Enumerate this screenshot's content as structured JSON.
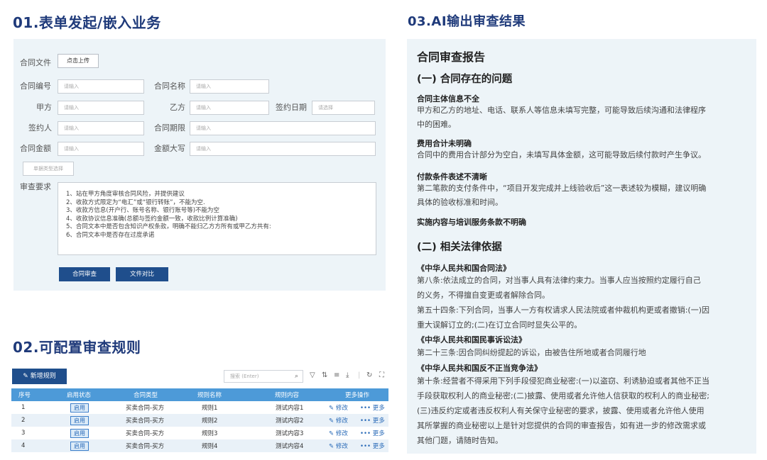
{
  "sections": {
    "s1": "01.表单发起/嵌入业务",
    "s2": "02.可配置审查规则",
    "s3": "03.AI输出审查结果"
  },
  "form": {
    "file_label": "合同文件",
    "upload_button": "点击上传",
    "fields": {
      "contract_no": "合同编号",
      "contract_name": "合同名称",
      "party_a": "甲方",
      "party_b": "乙方",
      "sign_date": "签约日期",
      "signer": "签约人",
      "period": "合同期限",
      "amount": "合同金额",
      "amount_upper": "金额大写"
    },
    "placeholder_input": "请输入",
    "placeholder_select": "请选择",
    "type_select": "单据类型选择",
    "req_label": "审查要求",
    "requirements": [
      "1、站在甲方角度审核合同风险，并提供建议",
      "2、收款方式限定为“电汇”或“银行转账”，不能为空.",
      "3、收款方信息(开户行、账号名称、银行账号等)不能为空",
      "4、收款协议信息准确(总额与签约金额一致，收款比例计算准确)",
      "5、合同文本中是否包含知识产权条款，明确不能归乙方方所有或甲乙方共有:",
      "6、合同文本中是否存在过度承诺"
    ],
    "review_button": "合同审查",
    "compare_button": "文件对比"
  },
  "rules": {
    "add_button": "新增规则",
    "search_placeholder": "搜索 (Enter)",
    "columns": [
      "序号",
      "启用状态",
      "合同类型",
      "规则名称",
      "规则内容",
      "更多操作"
    ],
    "rows": [
      {
        "no": "1",
        "status": "启用",
        "type": "买卖合同-买方",
        "name": "规则1",
        "content": "测试内容1",
        "edit": "修改",
        "more": "更多"
      },
      {
        "no": "2",
        "status": "启用",
        "type": "买卖合同-买方",
        "name": "规则2",
        "content": "测试内容2",
        "edit": "修改",
        "more": "更多"
      },
      {
        "no": "3",
        "status": "启用",
        "type": "买卖合同-买方",
        "name": "规则3",
        "content": "测试内容3",
        "edit": "修改",
        "more": "更多"
      },
      {
        "no": "4",
        "status": "启用",
        "type": "买卖合同-买方",
        "name": "规则4",
        "content": "测试内容4",
        "edit": "修改",
        "more": "更多"
      }
    ]
  },
  "report": {
    "title": "合同审查报告",
    "h_problems": "(一) 合同存在的问题",
    "p1_title": "合同主体信息不全",
    "p1_lines": [
      "甲方和乙方的地址、电话、联系人等信息未填写完整，可能导致后续沟通和法律程序",
      "中的困难。"
    ],
    "p2_title": "费用合计未明确",
    "p2_lines": [
      "合同中的费用合计部分为空白，未填写具体金额，这可能导致后续付款时产生争议。"
    ],
    "p3_title": "付款条件表述不清晰",
    "p3_lines": [
      "第二笔款的支付条件中，“项目开发完成并上线验收后”这一表述较为模糊，建议明确",
      "具体的验收标准和时间。"
    ],
    "p4_title": "实施内容与培训服务条款不明确",
    "h_law": "(二) 相关法律依据",
    "law1": "《中华人民共和国合同法》",
    "law1_lines": [
      "第八条:依法成立的合同，对当事人具有法律约束力。当事人应当按照约定履行自己",
      "的义务，不得擅自变更或者解除合同。",
      "第五十四条:下列合同，当事人一方有权请求人民法院或者仲裁机构更或者撤销:(一)因",
      "重大误解订立的;(二)在订立合同时显失公平的。"
    ],
    "law2": "《中华人民共和国民事诉讼法》",
    "law2_lines": [
      "第二十三条:因合同纠纷提起的诉讼，由被告住所地或者合同履行地"
    ],
    "law3": "《中华人民共和国反不正当竞争法》",
    "law3_lines": [
      "第十条:经营者不得采用下列手段侵犯商业秘密:(一)以盗窃、利诱胁迫或者其他不正当",
      "手段获取权利人的商业秘密;(二)披露、使用或者允许他人信获取的权利人的商业秘密;",
      "(三)违反约定或者违反权利人有关保守业秘密的要求，披露、使用或者允许他人使用",
      "其所掌握的商业秘密以上是针对您提供的合同的审查报告，如有进一步的修改需求或",
      "其他门题，请随时告知。"
    ]
  }
}
